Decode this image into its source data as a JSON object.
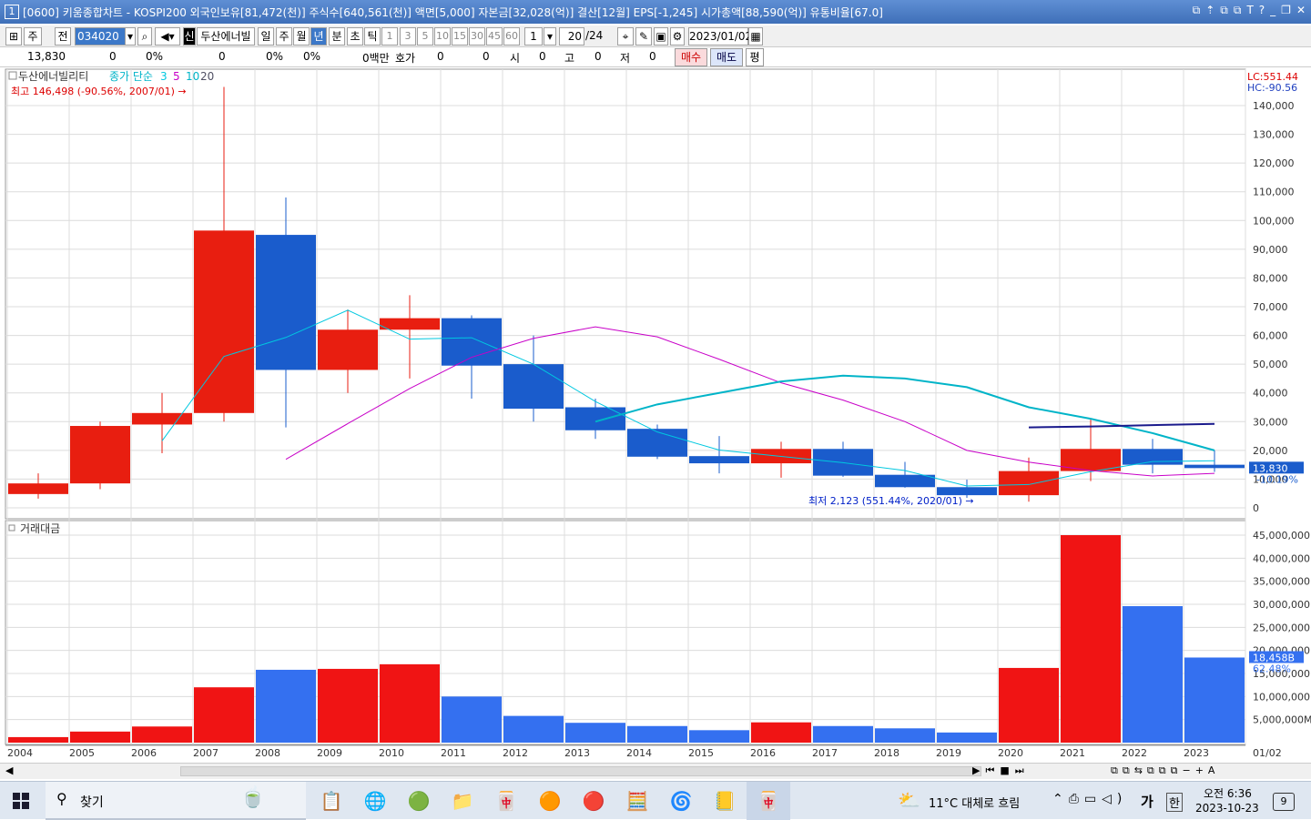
{
  "window": {
    "number": "1",
    "title": "[0600] 키움종합차트 - KOSPI200 외국인보유[81,472(천)] 주식수[640,561(천)] 액면[5,000] 자본금[32,028(억)] 결산[12월] EPS[-1,245] 시가총액[88,590(억)] 유통비율[67.0]",
    "buttons": [
      "⧉",
      "⇡",
      "⧉",
      "⧉",
      "T",
      "?",
      "_",
      "❐",
      "✕"
    ]
  },
  "toolbar": {
    "market": "주",
    "all": "전",
    "code": "034020",
    "new_label": "신",
    "stock_name": "두산에너빌",
    "periods": [
      "일",
      "주",
      "월",
      "년",
      "분",
      "초",
      "틱"
    ],
    "active_period": "년",
    "intervals": [
      "1",
      "3",
      "5",
      "10",
      "15",
      "30",
      "45",
      "60"
    ],
    "interval_value": "1",
    "count": "20",
    "count_total": "/24",
    "date": "2023/01/02"
  },
  "infobar": {
    "price": "13,830",
    "change": "0",
    "change_pct": "0%",
    "volume": "0",
    "vol_pct": "0%",
    "vol_pct2": "0%",
    "amount": "0백만",
    "bid_label": "호가",
    "bid": "0",
    "bid2": "0",
    "open_label": "시",
    "open": "0",
    "high_label": "고",
    "high": "0",
    "low_label": "저",
    "low": "0",
    "buy_label": "매수",
    "sell_label": "매도",
    "eval_label": "평"
  },
  "price_panel": {
    "stock_label": "두산에너빌리티",
    "ma_label": "종가 단순",
    "ma_periods": [
      "3",
      "5",
      "10",
      "20"
    ],
    "ma_colors": [
      "#00c8e0",
      "#c800c8",
      "#00b4c8",
      "#505064"
    ],
    "high_annotation": "최고 146,498 (-90.56%, 2007/01) →",
    "low_annotation": "최저 2,123 (551.44%, 2020/01) →",
    "lc": "LC:551.44",
    "hc": "HC:-90.56",
    "current_price": "13,830",
    "current_pct": "-10.19%",
    "y_labels": [
      "140,000",
      "130,000",
      "120,000",
      "110,000",
      "100,000",
      "90,000",
      "80,000",
      "70,000",
      "60,000",
      "50,000",
      "40,000",
      "30,000",
      "20,000",
      "10,000",
      "0"
    ]
  },
  "volume_panel": {
    "label": "거래대금",
    "current_value": "18,458B",
    "current_pct": "62.48%",
    "y_labels": [
      "45,000,000",
      "40,000,000",
      "35,000,000",
      "30,000,000",
      "25,000,000",
      "20,000,000",
      "15,000,000",
      "10,000,000",
      "5,000,000M"
    ]
  },
  "x_labels": [
    "2004",
    "2005",
    "2006",
    "2007",
    "2008",
    "2009",
    "2010",
    "2011",
    "2012",
    "2013",
    "2014",
    "2015",
    "2016",
    "2017",
    "2018",
    "2019",
    "2020",
    "2021",
    "2022",
    "2023"
  ],
  "x_end_label": "01/02",
  "chart_data": {
    "type": "candlestick",
    "categories": [
      "2004",
      "2005",
      "2006",
      "2007",
      "2008",
      "2009",
      "2010",
      "2011",
      "2012",
      "2013",
      "2014",
      "2015",
      "2016",
      "2017",
      "2018",
      "2019",
      "2020",
      "2021",
      "2022",
      "2023"
    ],
    "ohlc": [
      [
        4800,
        12000,
        3200,
        8500
      ],
      [
        8500,
        30000,
        6500,
        28500
      ],
      [
        29000,
        40000,
        19000,
        33000
      ],
      [
        33000,
        146498,
        30000,
        96500
      ],
      [
        95000,
        108000,
        28000,
        48000
      ],
      [
        48000,
        69000,
        40000,
        62000
      ],
      [
        62000,
        74000,
        45000,
        66000
      ],
      [
        66000,
        67000,
        38000,
        49500
      ],
      [
        50000,
        60000,
        30000,
        34500
      ],
      [
        35000,
        38000,
        24000,
        27000
      ],
      [
        27500,
        29000,
        17000,
        17800
      ],
      [
        18000,
        25000,
        12000,
        15500
      ],
      [
        15500,
        23000,
        10500,
        20500
      ],
      [
        20500,
        23000,
        10800,
        11200
      ],
      [
        11500,
        16000,
        7000,
        7200
      ],
      [
        7200,
        9800,
        3500,
        4400
      ],
      [
        4400,
        17500,
        2123,
        12800
      ],
      [
        12800,
        31000,
        9300,
        20500
      ],
      [
        20500,
        24000,
        12000,
        15000
      ],
      [
        15000,
        20000,
        12500,
        13830
      ]
    ],
    "moving_averages": [
      {
        "name": "3",
        "values": [
          null,
          null,
          23300,
          52700,
          59300,
          68800,
          58700,
          59200,
          50000,
          37000,
          26400,
          20100,
          17900,
          15700,
          13000,
          7600,
          8100,
          12600,
          16100,
          16400
        ]
      },
      {
        "name": "5",
        "values": [
          null,
          null,
          null,
          null,
          16900,
          29300,
          41500,
          52400,
          59000,
          63000,
          59500,
          51700,
          43500,
          37500,
          30000,
          20000,
          15900,
          13000,
          11100,
          12000
        ]
      },
      {
        "name": "10",
        "values": [
          null,
          null,
          null,
          null,
          null,
          null,
          null,
          null,
          null,
          30000,
          36000,
          40000,
          44000,
          46000,
          45000,
          42000,
          35000,
          31000,
          26000,
          20000
        ]
      },
      {
        "name": "20",
        "values": [
          null,
          null,
          null,
          null,
          null,
          null,
          null,
          null,
          null,
          null,
          null,
          null,
          null,
          null,
          null,
          null,
          28000,
          28300,
          28800,
          29200
        ]
      }
    ],
    "trading_value": [
      1200000,
      2400000,
      3500000,
      12000000,
      15800000,
      16000000,
      17000000,
      10000000,
      5800000,
      4300000,
      3600000,
      2700000,
      4400000,
      3600000,
      3100000,
      2200000,
      16200000,
      45000000,
      29600000,
      18458000
    ],
    "ylim_price": [
      0,
      146498
    ],
    "ylim_value": [
      0,
      45000000
    ]
  },
  "taskbar": {
    "search": "찾기",
    "weather": "11°C  대체로 흐림",
    "ime": "가",
    "lang": "한",
    "time": "오전 6:36",
    "date": "2023-10-23",
    "notifications": "9"
  }
}
